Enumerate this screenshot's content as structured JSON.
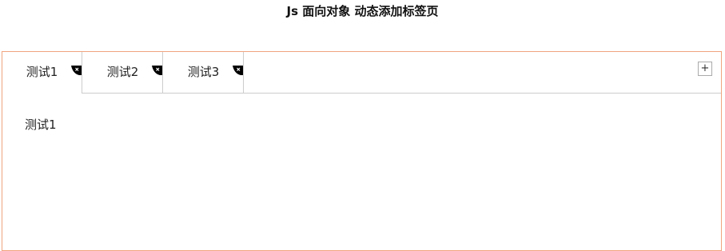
{
  "page": {
    "title": "Js 面向对象 动态添加标签页"
  },
  "tabs": [
    {
      "label": "测试1",
      "active": true,
      "close_icon": "close-icon"
    },
    {
      "label": "测试2",
      "active": false,
      "close_icon": "close-icon"
    },
    {
      "label": "测试3",
      "active": false,
      "close_icon": "close-icon"
    }
  ],
  "add_button": {
    "label": "+"
  },
  "content": {
    "text": "测试1"
  },
  "colors": {
    "container_border": "#f0a47e",
    "divider": "#cccccc",
    "close_badge": "#000000"
  }
}
